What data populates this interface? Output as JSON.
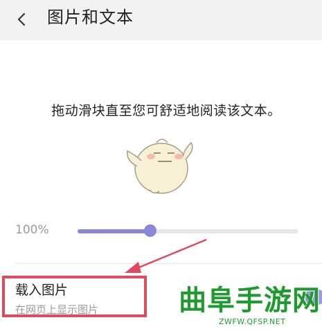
{
  "header": {
    "title": "图片和文本",
    "back_icon": "chevron-left-icon"
  },
  "preview": {
    "text": "拖动滑块直至您可舒适地阅读该文本。",
    "mascot_icon": "mascot-illustration"
  },
  "text_size": {
    "label": "100%",
    "level": 0.33
  },
  "load_images": {
    "title": "载入图片",
    "subtitle": "在网页上显示图片"
  },
  "watermark": {
    "text": "曲阜手游网",
    "url": "ZWFW.QFSP.NET"
  },
  "colors": {
    "accent": "#8a86d8",
    "highlight": "#e04a5e",
    "watermark": "#1f9a2e"
  }
}
